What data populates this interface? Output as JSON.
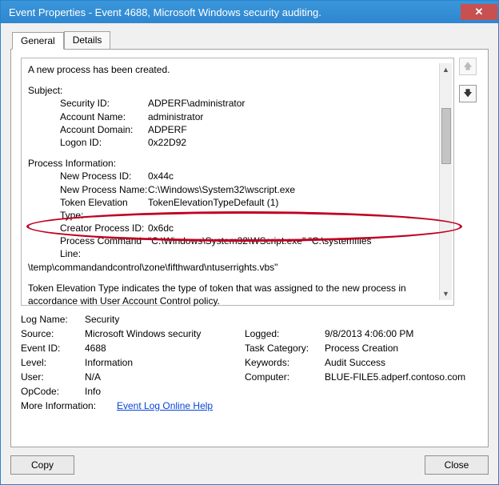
{
  "window": {
    "title": "Event Properties - Event 4688, Microsoft Windows security auditing."
  },
  "tabs": {
    "general": "General",
    "details": "Details"
  },
  "event": {
    "header": "A new process has been created.",
    "subject_label": "Subject:",
    "subject": {
      "security_id_label": "Security ID:",
      "security_id": "ADPERF\\administrator",
      "account_name_label": "Account Name:",
      "account_name": "administrator",
      "account_domain_label": "Account Domain:",
      "account_domain": "ADPERF",
      "logon_id_label": "Logon ID:",
      "logon_id": "0x22D92"
    },
    "process_label": "Process Information:",
    "process": {
      "new_pid_label": "New Process ID:",
      "new_pid": "0x44c",
      "new_pname_label": "New Process Name:",
      "new_pname": "C:\\Windows\\System32\\wscript.exe",
      "tet_label": "Token Elevation Type:",
      "tet": "TokenElevationTypeDefault (1)",
      "creator_pid_label": "Creator Process ID:",
      "creator_pid": "0x6dc",
      "cmdline_label": "Process Command Line:",
      "cmdline1": "\"C:\\Windows\\System32\\WScript.exe\" \"C:\\systemfiles",
      "cmdline2": "\\temp\\commandandcontrol\\zone\\fifthward\\ntuserrights.vbs\""
    },
    "explain": "Token Elevation Type indicates the type of token that was assigned to the new process in accordance with User Account Control policy."
  },
  "details": {
    "log_name_label": "Log Name:",
    "log_name": "Security",
    "source_label": "Source:",
    "source": "Microsoft Windows security",
    "logged_label": "Logged:",
    "logged": "9/8/2013 4:06:00 PM",
    "event_id_label": "Event ID:",
    "event_id": "4688",
    "task_cat_label": "Task Category:",
    "task_cat": "Process Creation",
    "level_label": "Level:",
    "level": "Information",
    "keywords_label": "Keywords:",
    "keywords": "Audit Success",
    "user_label": "User:",
    "user": "N/A",
    "computer_label": "Computer:",
    "computer": "BLUE-FILE5.adperf.contoso.com",
    "opcode_label": "OpCode:",
    "opcode": "Info",
    "moreinfo_label": "More Information:",
    "moreinfo_link": "Event Log Online Help"
  },
  "buttons": {
    "copy": "Copy",
    "close": "Close"
  }
}
